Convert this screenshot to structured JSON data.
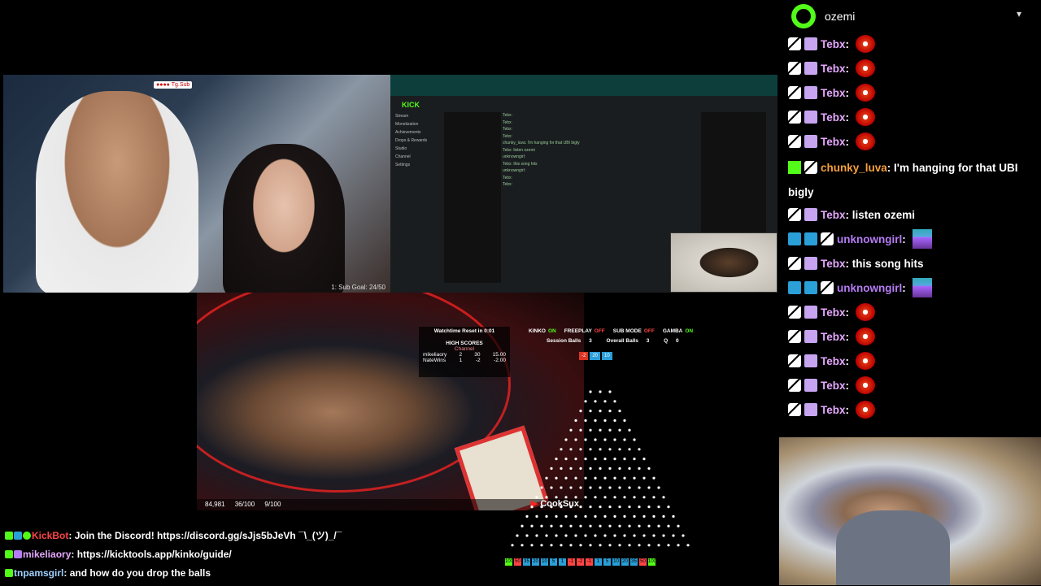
{
  "top_left_cam": {
    "overlay": "●●●● Tg.Sub",
    "sub_goal": "1: Sub Goal: 24/50"
  },
  "screen_share": {
    "kick_logo": "KICK",
    "sidebar": [
      "Stream",
      "Monetization",
      "Achievements",
      "Drops & Rewards",
      "Studio",
      "Channel",
      "Settings"
    ],
    "chat_lines": [
      "Tebx: ",
      "Tebx: ",
      "Tebx: ",
      "Tebx: ",
      "chunky_luva: I'm hanging for that UBI bigly",
      "Tebx: listen ozemi",
      "unknowngirl: ",
      "Tebx: this song hits",
      "unknowngirl: ",
      "Tebx: ",
      "Tebx: "
    ]
  },
  "bottom_cam": {
    "hud": {
      "viewers": "84,981",
      "subs": "36/100",
      "gifts": "9/100"
    },
    "watermark": "CookSux"
  },
  "scoreboard": {
    "watchtime": "Watchtime Reset in 0:01",
    "high_scores": "HIGH SCORES",
    "channel": "Channel",
    "rows": [
      {
        "name": "mikeliaory",
        "a": "2",
        "b": "30",
        "c": "15.00"
      },
      {
        "name": "NateWins",
        "a": "1",
        "b": "-2",
        "c": "-2.00"
      }
    ]
  },
  "plinko": {
    "status": [
      {
        "label": "KINKO",
        "state": "ON"
      },
      {
        "label": "FREEPLAY",
        "state": "OFF"
      },
      {
        "label": "SUB MODE",
        "state": "OFF"
      },
      {
        "label": "GAMBA",
        "state": "ON"
      }
    ],
    "stats": {
      "session_label": "Session Balls",
      "session": "3",
      "overall_label": "Overall Balls",
      "overall": "3",
      "q_label": "Q",
      "q": "0"
    },
    "counters": [
      "-2",
      "20",
      "10"
    ],
    "bins": [
      "100",
      "50",
      "35",
      "20",
      "10",
      "5",
      "1",
      "-1",
      "-2",
      "-1",
      "1",
      "5",
      "10",
      "20",
      "35",
      "50",
      "100"
    ],
    "bin_colors": [
      "#53fc18",
      "#f44",
      "#2a9fd8",
      "#2a9fd8",
      "#2a9fd8",
      "#2a9fd8",
      "#2a9fd8",
      "#f44",
      "#f44",
      "#f44",
      "#2a9fd8",
      "#2a9fd8",
      "#2a9fd8",
      "#2a9fd8",
      "#2a9fd8",
      "#f44",
      "#53fc18"
    ]
  },
  "bottom_chat": [
    {
      "user": "KickBot",
      "color": "#f44",
      "text": "Join the Discord! https://discord.gg/sJjs5bJeVh ¯\\_(ツ)_/¯"
    },
    {
      "user": "mikeliaory",
      "color": "#e6a8ff",
      "text": "https://kicktools.app/kinko/guide/"
    },
    {
      "user": "tnpamsgirl",
      "color": "#9fd0ff",
      "text": "and how do you drop the balls"
    }
  ],
  "right_chat": {
    "channel": "ozemi",
    "messages": [
      {
        "user": "Tebx",
        "text": "",
        "emote": "red"
      },
      {
        "user": "Tebx",
        "text": "",
        "emote": "red"
      },
      {
        "user": "Tebx",
        "text": "",
        "emote": "red"
      },
      {
        "user": "Tebx",
        "text": "",
        "emote": "red"
      },
      {
        "user": "Tebx",
        "text": "",
        "emote": "red"
      },
      {
        "user": "chunky_luva",
        "text": "I'm hanging for that UBI bigly",
        "emote": ""
      },
      {
        "user": "Tebx",
        "text": "listen ozemi",
        "emote": ""
      },
      {
        "user": "unknowngirl",
        "text": "",
        "emote": "pix"
      },
      {
        "user": "Tebx",
        "text": "this song hits",
        "emote": ""
      },
      {
        "user": "unknowngirl",
        "text": "",
        "emote": "pix"
      },
      {
        "user": "Tebx",
        "text": "",
        "emote": "red"
      },
      {
        "user": "Tebx",
        "text": "",
        "emote": "red"
      },
      {
        "user": "Tebx",
        "text": "",
        "emote": "red"
      },
      {
        "user": "Tebx",
        "text": "",
        "emote": "red"
      },
      {
        "user": "Tebx",
        "text": "",
        "emote": "red"
      }
    ]
  }
}
